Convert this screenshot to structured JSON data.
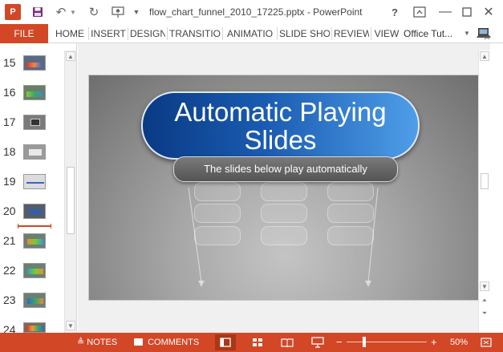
{
  "titlebar": {
    "app_logo": "P",
    "document_title": "flow_chart_funnel_2010_17225.pptx - PowerPoint",
    "help": "?",
    "icons": [
      "save-icon",
      "undo-icon",
      "redo-icon",
      "present-from-start-icon",
      "customize-qat-icon",
      "ribbon-display-options-icon",
      "minimize-icon",
      "maximize-icon",
      "close-icon"
    ]
  },
  "ribbon": {
    "file": "FILE",
    "tabs": [
      "HOME",
      "INSERT",
      "DESIGN",
      "TRANSITIO",
      "ANIMATIO",
      "SLIDE SHO",
      "REVIEW",
      "VIEW"
    ],
    "account": "Office Tut..."
  },
  "thumbnails": [
    {
      "number": "15"
    },
    {
      "number": "16"
    },
    {
      "number": "17"
    },
    {
      "number": "18"
    },
    {
      "number": "19"
    },
    {
      "number": "20"
    },
    {
      "number": "21"
    },
    {
      "number": "22"
    },
    {
      "number": "23"
    },
    {
      "number": "24"
    }
  ],
  "slide": {
    "title": "Automatic Playing Slides",
    "subtitle": "The slides below play automatically"
  },
  "statusbar": {
    "notes": "NOTES",
    "comments": "COMMENTS",
    "zoom_out": "−",
    "zoom_in": "+",
    "zoom_level": "50%"
  },
  "colors": {
    "accent": "#d24726",
    "title_pill_dark": "#0a3a84",
    "title_pill_light": "#4f9ee8"
  }
}
